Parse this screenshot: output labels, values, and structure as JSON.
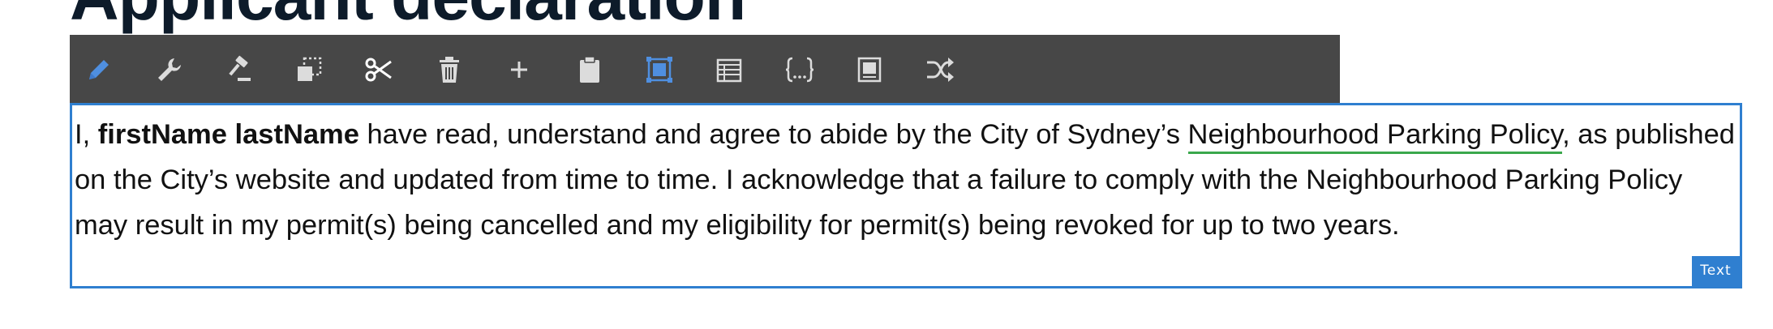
{
  "page": {
    "heading": "Applicant declaration"
  },
  "toolbar": {
    "tools": [
      {
        "icon": "pencil-icon",
        "label": "edit",
        "color": "#4f8fe0"
      },
      {
        "icon": "wrench-icon",
        "label": "settings",
        "color": "#dcdcdc"
      },
      {
        "icon": "gavel-icon",
        "label": "rules",
        "color": "#dcdcdc"
      },
      {
        "icon": "copy-icon",
        "label": "copy",
        "color": "#dcdcdc"
      },
      {
        "icon": "scissors-icon",
        "label": "cut",
        "color": "#ffffff"
      },
      {
        "icon": "trash-icon",
        "label": "delete",
        "color": "#dcdcdc"
      },
      {
        "icon": "plus-icon",
        "label": "add",
        "color": "#dcdcdc"
      },
      {
        "icon": "clipboard-icon",
        "label": "paste",
        "color": "#dcdcdc"
      },
      {
        "icon": "select-box-icon",
        "label": "select",
        "color": "#4f8fe0"
      },
      {
        "icon": "table-icon",
        "label": "table",
        "color": "#dcdcdc"
      },
      {
        "icon": "braces-icon",
        "label": "code",
        "color": "#dcdcdc"
      },
      {
        "icon": "frame-icon",
        "label": "wrap",
        "color": "#dcdcdc"
      },
      {
        "icon": "shuffle-icon",
        "label": "shuffle",
        "color": "#dcdcdc"
      }
    ]
  },
  "declaration": {
    "prefix": "I, ",
    "name": "firstName lastName",
    "text_before_link": " have read, understand and agree to abide by the City of Sydney’s ",
    "link_text": "Neighbourhood Parking Policy",
    "text_after_link": ", as published on the City’s website and updated from time to time. I acknowledge that a failure to comply with the Neighbourhood Parking Policy may result in my permit(s) being cancelled and my eligibility for permit(s) being revoked for up to two years.",
    "type_badge": "Text"
  },
  "colors": {
    "toolbar_bg": "#474747",
    "selection_border": "#2f7fd0",
    "link_underline": "#3aa84c",
    "heading": "#0d1b2a"
  }
}
